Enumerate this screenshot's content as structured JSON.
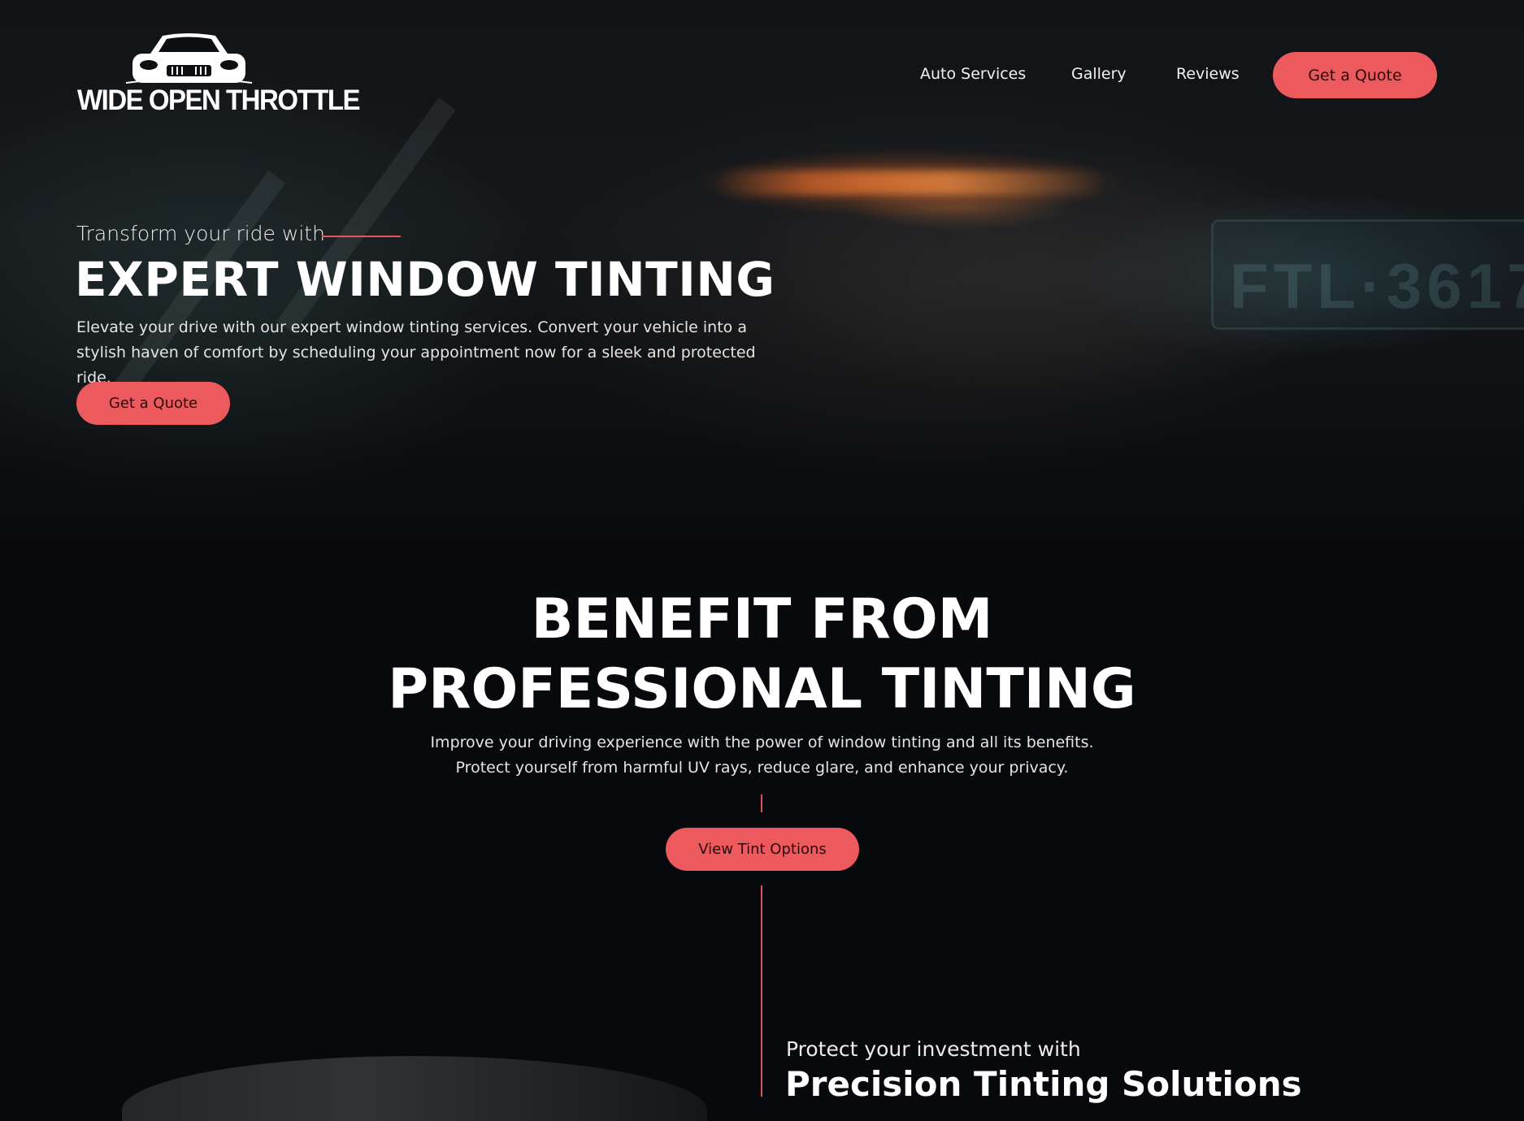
{
  "brand": {
    "name": "WIDE OPEN THROTTLE",
    "logo_icon": "car-front-icon"
  },
  "background": {
    "plate_text": "FTL·3617"
  },
  "nav": {
    "items": [
      {
        "label": "Auto Services"
      },
      {
        "label": "Gallery"
      },
      {
        "label": "Reviews"
      }
    ],
    "cta_label": "Get a Quote"
  },
  "hero": {
    "kicker": "Transform your ride with",
    "title": "EXPERT WINDOW TINTING",
    "description": "Elevate your drive with our expert window tinting services. Convert your vehicle into a stylish haven of comfort by scheduling your appointment now for a sleek and protected ride.",
    "cta_label": "Get a Quote"
  },
  "benefits": {
    "title_line1": "BENEFIT FROM",
    "title_line2": "PROFESSIONAL TINTING",
    "description": "Improve your driving experience with the power of window tinting and all its benefits. Protect yourself from harmful UV rays, reduce glare, and enhance your privacy.",
    "cta_label": "View Tint Options"
  },
  "precision": {
    "kicker": "Protect your investment with",
    "title": "Precision Tinting Solutions"
  },
  "colors": {
    "accent": "#ec5a5d",
    "background": "#08090c",
    "text": "#ffffff"
  }
}
